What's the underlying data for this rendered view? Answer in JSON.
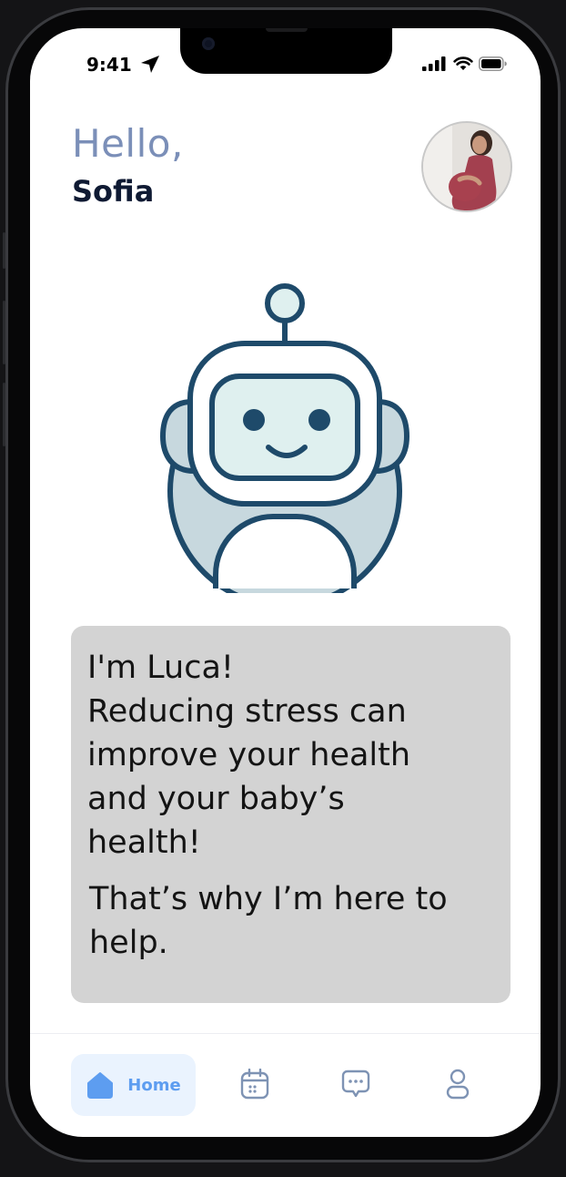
{
  "status_bar": {
    "time": "9:41",
    "icons": [
      "location-arrow-icon",
      "cellular-signal-icon",
      "wifi-icon",
      "battery-icon"
    ]
  },
  "header": {
    "greeting": "Hello,",
    "name": "Sofia"
  },
  "avatar": {
    "icon": "profile-photo"
  },
  "assistant": {
    "icon": "robot-icon",
    "message_lines": [
      "I'm Luca!",
      "Reducing stress can",
      "improve your health",
      "and your baby’s",
      "health!"
    ],
    "message_follow_lines": [
      "That’s why I’m here to",
      "help."
    ]
  },
  "bottom_nav": {
    "items": [
      {
        "label": "Home",
        "icon": "home-icon",
        "active": true
      },
      {
        "label": "",
        "icon": "calendar-icon",
        "active": false
      },
      {
        "label": "",
        "icon": "chat-icon",
        "active": false
      },
      {
        "label": "",
        "icon": "profile-icon",
        "active": false
      }
    ]
  },
  "colors": {
    "accent": "#5d9df0",
    "accent_bg": "#eaf3fe",
    "greeting": "#7b8fb8",
    "name": "#0f1a33",
    "robot_outline": "#1e4a6a",
    "robot_face": "#dff0ef",
    "robot_body": "#c7d8de",
    "bubble": "#d3d3d3"
  }
}
